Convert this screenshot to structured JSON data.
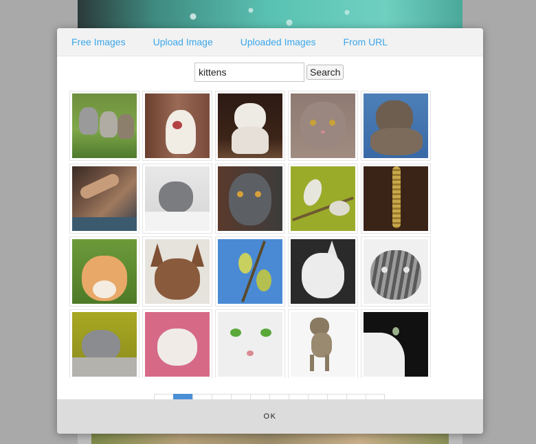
{
  "tabs": [
    "Free Images",
    "Upload Image",
    "Uploaded Images",
    "From URL"
  ],
  "search": {
    "value": "kittens",
    "button_label": "Search"
  },
  "thumbnails": [
    "kittens-on-grass",
    "kitten-yawning",
    "white-kitten-sitting",
    "grey-cat-portrait",
    "tabby-kitten-on-blue",
    "hands-closeup",
    "grey-kitten-lying",
    "grey-cat-staring",
    "pussy-willow-branch",
    "hanging-catkin",
    "orange-cat-in-grass",
    "brown-oriental-kitten",
    "pussy-willow-blue-sky",
    "white-oriental-kitten",
    "tabby-cat-bw",
    "grey-cat-on-log",
    "kitten-in-pink-blanket",
    "white-cat-green-eyes",
    "tabby-kitten-walking",
    "black-white-cat-profile"
  ],
  "pagination": {
    "page_count": 12,
    "active_page": 2
  },
  "footer": {
    "ok_label": "OK"
  },
  "colors": {
    "tab_link": "#3aa6e8",
    "active_page": "#4b8fd6"
  }
}
